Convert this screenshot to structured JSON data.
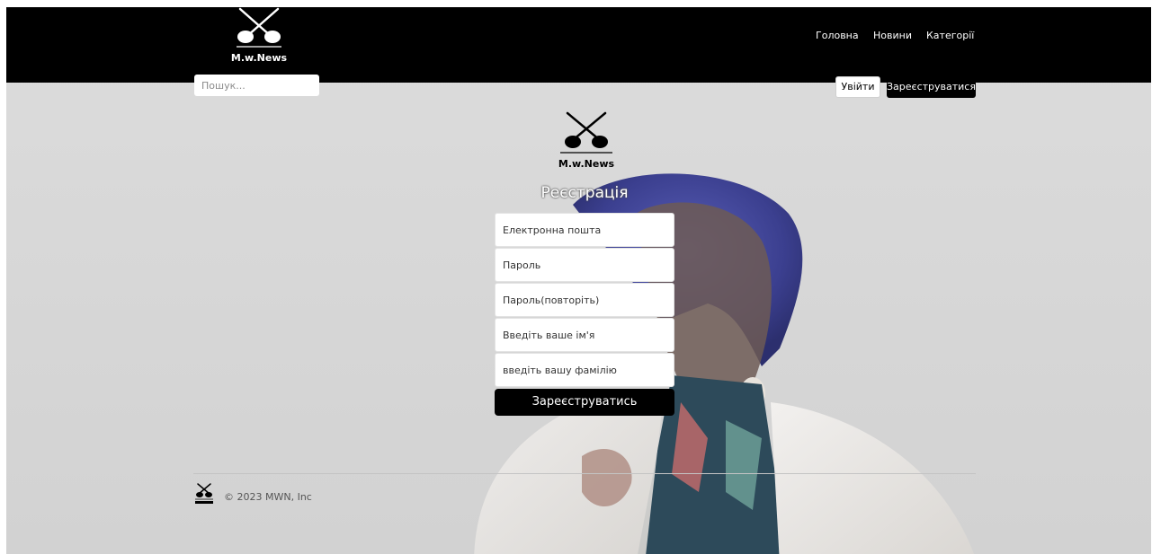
{
  "brand": {
    "logo_text": "M.w.News"
  },
  "header": {
    "nav": {
      "home": "Головна",
      "news": "Новини",
      "categories": "Категорії"
    },
    "search": {
      "placeholder": "Пошук..."
    },
    "login_label": "Увійти",
    "register_label": "Зареєструватися"
  },
  "form": {
    "title": "Реєстрація",
    "fields": {
      "email_placeholder": "Електронна пошта",
      "password_placeholder": "Пароль",
      "password_repeat_placeholder": "Пароль(повторіть)",
      "first_name_placeholder": "Введіть ваше ім'я",
      "last_name_placeholder": "введіть вашу фамілію"
    },
    "submit_label": "Зареєструватись"
  },
  "footer": {
    "copyright": "© 2023 MWN, Inc"
  },
  "colors": {
    "header_bg": "#000000",
    "page_bg": "#d8d8d8",
    "accent": "#000000"
  }
}
